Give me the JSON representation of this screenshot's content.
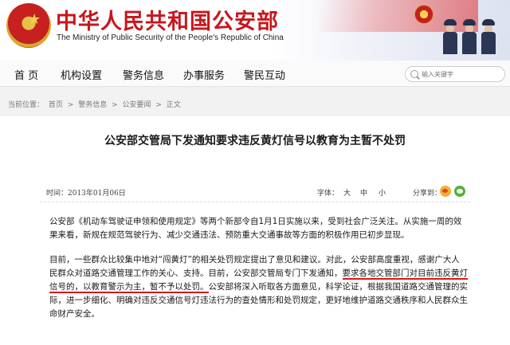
{
  "header": {
    "title_cn": "中华人民共和国公安部",
    "title_en": "The Ministry of Public Security of the People's Republic of China"
  },
  "nav": {
    "items": [
      "首 页",
      "机构设置",
      "警务信息",
      "办事服务",
      "警民互动"
    ]
  },
  "search": {
    "placeholder": "输入关键字"
  },
  "breadcrumb": {
    "label": "当前位置：",
    "items": [
      "首页",
      "警务信息",
      "公安要闻",
      "正文"
    ],
    "separator": ">"
  },
  "article": {
    "title": "公安部交管局下发通知要求违反黄灯信号以教育为主暂不处罚",
    "date": "时间：2013年01月06日",
    "font_label": "字体：",
    "font_sizes": [
      "大",
      "中",
      "小"
    ],
    "share_label": "分享到：",
    "paragraph1": [
      "公安部《机动车驾驶证申领和使用规定》等两个新部令自1月1日实施以来，受到社会广泛关注。从实施一周的效",
      "果来看，新规在规范驾驶行为、减少交通违法、预防重大交通事故等方面的积极作用已初步显现。"
    ],
    "paragraph2": {
      "line1": "目前，一些群众比较集中地对“闯黄灯”的相关处罚规定提出了意见和建议。对此，公安部高度重视，感谢广大人",
      "line2": "民群众对道路交通管理工作的关心、支持。目前，公安部交管局专门下发通知，",
      "line2_highlight": "要求各地交管部门对目前违反黄灯",
      "line3_highlight": "信号的，以教育警示为主，暂不予以处罚。",
      "line3": "公安部将深入听取各方面意见，科学论证，根据我国道路交通管理的实",
      "line4": "际，进一步细化、明确对违反交通信号灯违法行为的查处情形和处罚规定，更好地维护道路交通秩序和人民群众生",
      "line5": "命财产安全。"
    }
  },
  "icons": {
    "emblem": "national-emblem-icon",
    "badge": "police-badge-icon",
    "search": "search-icon",
    "weibo": "weibo-icon",
    "wechat": "wechat-icon"
  },
  "colors": {
    "brand_red": "#c8161d",
    "highlight_underline": "#d9141c"
  }
}
